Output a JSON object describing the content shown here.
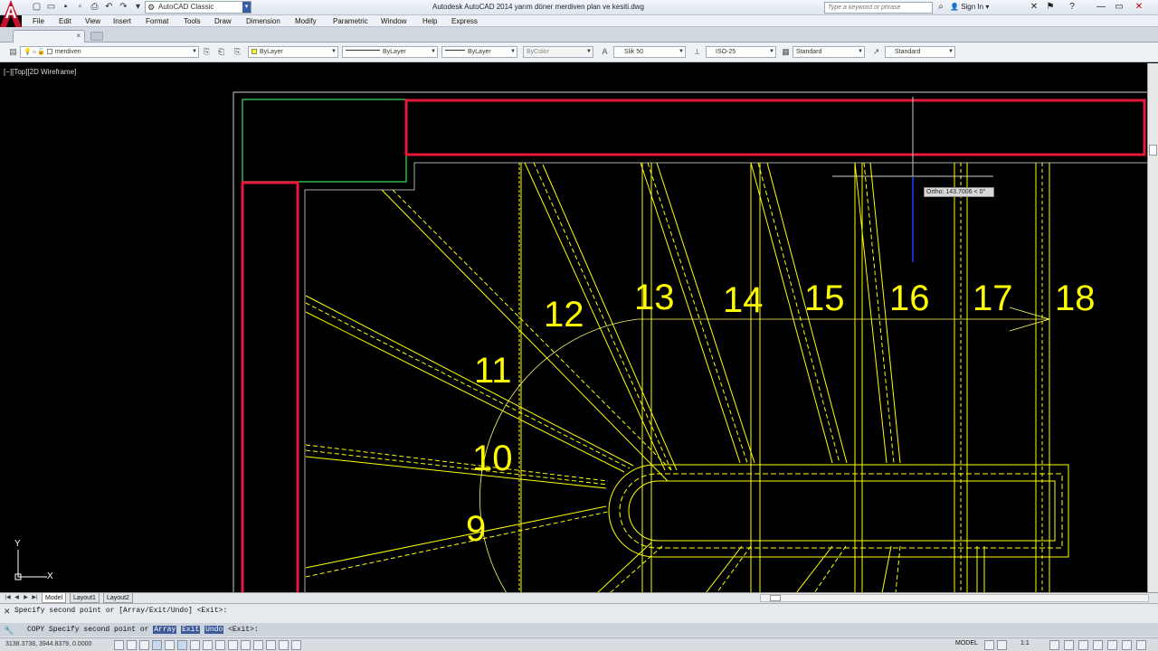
{
  "window": {
    "title": "Autodesk AutoCAD 2014    yarım döner merdiven plan ve kesiti.dwg",
    "workspace": "AutoCAD Classic",
    "search_placeholder": "Type a keyword or phrase",
    "sign_in": "Sign In"
  },
  "menu": [
    "File",
    "Edit",
    "View",
    "Insert",
    "Format",
    "Tools",
    "Draw",
    "Dimension",
    "Modify",
    "Parametric",
    "Window",
    "Help",
    "Express"
  ],
  "properties": {
    "layer": "merdiven",
    "color": "ByLayer",
    "linetype": "ByLayer",
    "lineweight": "ByLayer",
    "plotstyle": "ByColor",
    "text_style": "Slik 50",
    "dim_style": "ISO-25",
    "table_style": "Standard",
    "multileader_style": "Standard"
  },
  "viewport": {
    "label": "[−][Top][2D Wireframe]",
    "ortho_tooltip": "Ortho: 143.7006 < 0°",
    "ucs_x": "X",
    "ucs_y": "Y"
  },
  "drawing": {
    "step_numbers": [
      "9",
      "10",
      "11",
      "12",
      "13",
      "14",
      "15",
      "16",
      "17",
      "18"
    ],
    "colors": {
      "background": "#000000",
      "walls": "#e8173c",
      "landing": "#2fb84a",
      "stair": "#ffff00",
      "frame": "#ffffff"
    }
  },
  "layout_tabs": [
    "Model",
    "Layout1",
    "Layout2"
  ],
  "command": {
    "history": "Specify second point or [Array/Exit/Undo] <Exit>:",
    "prompt": "COPY Specify second point or ",
    "options": [
      "Array",
      "Exit",
      "Undo"
    ],
    "default": " <Exit>:"
  },
  "status": {
    "coordinates": "3138.3738, 3944.8379, 0.0000",
    "model": "MODEL",
    "scale": "1:1"
  }
}
